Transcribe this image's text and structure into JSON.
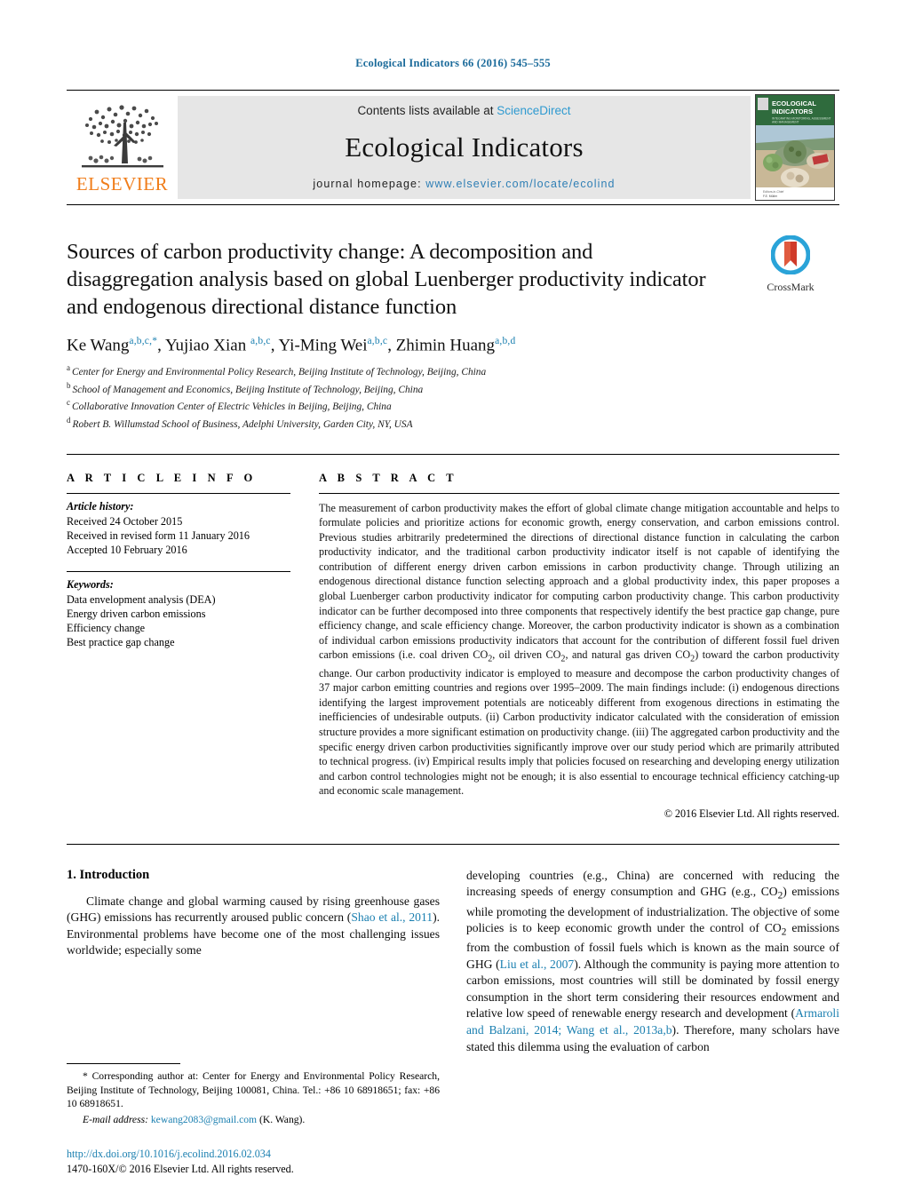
{
  "running_head": "Ecological Indicators 66 (2016) 545–555",
  "banner": {
    "publisher": "ELSEVIER",
    "contents_prefix": "Contents lists available at ",
    "contents_link": "ScienceDirect",
    "journal_name": "Ecological Indicators",
    "homepage_prefix": "journal homepage: ",
    "homepage_url": "www.elsevier.com/locate/ecolind",
    "cover_title_line1": "ECOLOGICAL",
    "cover_title_line2": "INDICATORS",
    "cover_subtitle": "INTEGRATING MONITORING, ASSESSMENT AND MANAGEMENT"
  },
  "crossmark": {
    "label": "CrossMark"
  },
  "article": {
    "title": "Sources of carbon productivity change: A decomposition and disaggregation analysis based on global Luenberger productivity indicator and endogenous directional distance function",
    "authors": [
      {
        "name": "Ke Wang",
        "marks": "a,b,c,*"
      },
      {
        "name": "Yujiao Xian",
        "marks": "a,b,c"
      },
      {
        "name": "Yi-Ming Wei",
        "marks": "a,b,c"
      },
      {
        "name": "Zhimin Huang",
        "marks": "a,b,d"
      }
    ],
    "affiliations": [
      {
        "mark": "a",
        "text": "Center for Energy and Environmental Policy Research, Beijing Institute of Technology, Beijing, China"
      },
      {
        "mark": "b",
        "text": "School of Management and Economics, Beijing Institute of Technology, Beijing, China"
      },
      {
        "mark": "c",
        "text": "Collaborative Innovation Center of Electric Vehicles in Beijing, Beijing, China"
      },
      {
        "mark": "d",
        "text": "Robert B. Willumstad School of Business, Adelphi University, Garden City, NY, USA"
      }
    ]
  },
  "info": {
    "heading": "A R T I C L E   I N F O",
    "history_label": "Article history:",
    "history": [
      "Received 24 October 2015",
      "Received in revised form 11 January 2016",
      "Accepted 10 February 2016"
    ],
    "keywords_label": "Keywords:",
    "keywords": [
      "Data envelopment analysis (DEA)",
      "Energy driven carbon emissions",
      "Efficiency change",
      "Best practice gap change"
    ]
  },
  "abstract": {
    "heading": "A B S T R A C T",
    "text": "The measurement of carbon productivity makes the effort of global climate change mitigation accountable and helps to formulate policies and prioritize actions for economic growth, energy conservation, and carbon emissions control. Previous studies arbitrarily predetermined the directions of directional distance function in calculating the carbon productivity indicator, and the traditional carbon productivity indicator itself is not capable of identifying the contribution of different energy driven carbon emissions in carbon productivity change. Through utilizing an endogenous directional distance function selecting approach and a global productivity index, this paper proposes a global Luenberger carbon productivity indicator for computing carbon productivity change. This carbon productivity indicator can be further decomposed into three components that respectively identify the best practice gap change, pure efficiency change, and scale efficiency change. Moreover, the carbon productivity indicator is shown as a combination of individual carbon emissions productivity indicators that account for the contribution of different fossil fuel driven carbon emissions (i.e. coal driven CO2, oil driven CO2, and natural gas driven CO2) toward the carbon productivity change. Our carbon productivity indicator is employed to measure and decompose the carbon productivity changes of 37 major carbon emitting countries and regions over 1995–2009. The main findings include: (i) endogenous directions identifying the largest improvement potentials are noticeably different from exogenous directions in estimating the inefficiencies of undesirable outputs. (ii) Carbon productivity indicator calculated with the consideration of emission structure provides a more significant estimation on productivity change. (iii) The aggregated carbon productivity and the specific energy driven carbon productivities significantly improve over our study period which are primarily attributed to technical progress. (iv) Empirical results imply that policies focused on researching and developing energy utilization and carbon control technologies might not be enough; it is also essential to encourage technical efficiency catching-up and economic scale management.",
    "copyright": "© 2016 Elsevier Ltd. All rights reserved."
  },
  "body": {
    "section_number_title": "1.  Introduction",
    "left_para_part1": "Climate change and global warming caused by rising greenhouse gases (GHG) emissions has recurrently aroused public concern (",
    "left_ref1": "Shao et al., 2011",
    "left_para_part2": "). Environmental problems have become one of the most challenging issues worldwide; especially some",
    "right_para_part1": "developing countries (e.g., China) are concerned with reducing the increasing speeds of energy consumption and GHG (e.g., CO2) emissions while promoting the development of industrialization. The objective of some policies is to keep economic growth under the control of CO2 emissions from the combustion of fossil fuels which is known as the main source of GHG (",
    "right_ref1": "Liu et al., 2007",
    "right_para_part2": "). Although the community is paying more attention to carbon emissions, most countries will still be dominated by fossil energy consumption in the short term considering their resources endowment and relative low speed of renewable energy research and development (",
    "right_ref2": "Armaroli and Balzani, 2014; Wang et al., 2013a,b",
    "right_para_part3": "). Therefore, many scholars have stated this dilemma using the evaluation of carbon"
  },
  "footnotes": {
    "corresponding_marker": "*",
    "corresponding_text": " Corresponding author at: Center for Energy and Environmental Policy Research, Beijing Institute of Technology, Beijing 100081, China. Tel.: +86 10 68918651; fax: +86 10 68918651.",
    "email_label": "E-mail address:",
    "email": "kewang2083@gmail.com",
    "email_suffix": " (K. Wang)."
  },
  "footer": {
    "doi": "http://dx.doi.org/10.1016/j.ecolind.2016.02.034",
    "issn_line": "1470-160X/© 2016 Elsevier Ltd. All rights reserved."
  },
  "colors": {
    "link_blue": "#1a7fb0",
    "sciencedirect_blue": "#2f9ad0",
    "elsevier_orange": "#f07d1a",
    "banner_gray": "#e6e6e6"
  }
}
